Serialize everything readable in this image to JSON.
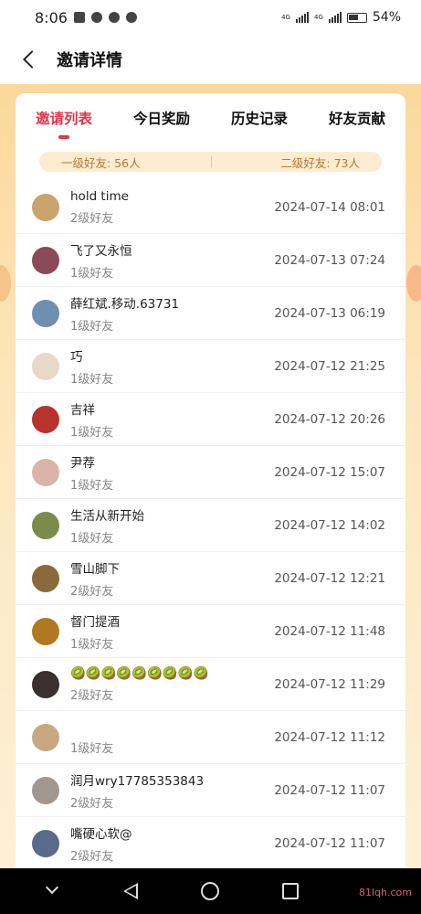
{
  "status_bar": {
    "time": "8:06",
    "battery": "54%"
  },
  "header": {
    "title": "邀请详情"
  },
  "tabs": [
    {
      "label": "邀请列表",
      "active": true
    },
    {
      "label": "今日奖励",
      "active": false
    },
    {
      "label": "历史记录",
      "active": false
    },
    {
      "label": "好友贡献",
      "active": false
    }
  ],
  "summary": {
    "level1": "一级好友: 56人",
    "level2": "二级好友: 73人"
  },
  "friends": [
    {
      "name": "hold time",
      "level": "2级好友",
      "time": "2024-07-14 08:01",
      "avatar_color": "#caa36d"
    },
    {
      "name": "飞了又永恒",
      "level": "1级好友",
      "time": "2024-07-13 07:24",
      "avatar_color": "#8a4a5a"
    },
    {
      "name": "薛红斌.移动.63731",
      "level": "1级好友",
      "time": "2024-07-13 06:19",
      "avatar_color": "#6f8fb0"
    },
    {
      "name": "巧",
      "level": "1级好友",
      "time": "2024-07-12 21:25",
      "avatar_color": "#e8d8c8"
    },
    {
      "name": "吉祥",
      "level": "1级好友",
      "time": "2024-07-12 20:26",
      "avatar_color": "#b8322e"
    },
    {
      "name": "尹荐",
      "level": "1级好友",
      "time": "2024-07-12 15:07",
      "avatar_color": "#d9b4a8"
    },
    {
      "name": "生活从新开始",
      "level": "1级好友",
      "time": "2024-07-12 14:02",
      "avatar_color": "#7c8a4a"
    },
    {
      "name": "雪山脚下",
      "level": "2级好友",
      "time": "2024-07-12 12:21",
      "avatar_color": "#8a6a3a"
    },
    {
      "name": "督门提酒",
      "level": "1级好友",
      "time": "2024-07-12 11:48",
      "avatar_color": "#b07820"
    },
    {
      "name": "🥝🥝🥝🥝🥝🥝🥝🥝🥝",
      "level": "2级好友",
      "time": "2024-07-12 11:29",
      "avatar_color": "#3a3030"
    },
    {
      "name": "",
      "level": "1级好友",
      "time": "2024-07-12 11:12",
      "avatar_color": "#c8a880"
    },
    {
      "name": "润月wry17785353843",
      "level": "2级好友",
      "time": "2024-07-12 11:07",
      "avatar_color": "#a09890"
    },
    {
      "name": "嘴硬心软@",
      "level": "2级好友",
      "time": "2024-07-12 11:07",
      "avatar_color": "#5a6a8a"
    }
  ],
  "watermark": "81lqh.com"
}
